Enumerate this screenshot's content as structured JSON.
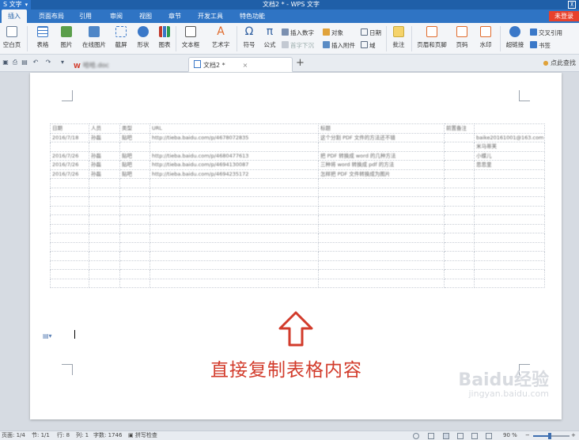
{
  "titlebar": {
    "app_name": "S 文字",
    "doc_title": "文档2 * - WPS 文字",
    "window_button": "⊼"
  },
  "menubar": {
    "tabs": [
      "插入",
      "页面布局",
      "引用",
      "审阅",
      "视图",
      "章节",
      "开发工具",
      "特色功能"
    ],
    "active_tab": "插入",
    "login": "未登录"
  },
  "ribbon": {
    "blank_page": "空白页",
    "table": "表格",
    "picture": "图片",
    "online_picture": "在线图片",
    "screenshot": "截屏",
    "shapes": "形状",
    "chart": "图表",
    "textbox": "文本框",
    "art_text": "艺术字",
    "symbol": "符号",
    "formula": "公式",
    "insert_number": "插入数字",
    "object": "对象",
    "date": "日期",
    "drop_cap": "首字下沉",
    "insert_attachment": "插入附件",
    "field": "域",
    "comment": "批注",
    "header_footer": "页眉和页脚",
    "page_number": "页码",
    "watermark": "水印",
    "hyperlink": "超链接",
    "cross_reference": "交叉引用",
    "bookmark": "书签"
  },
  "tabs": {
    "doc1": "哈哈.doc",
    "doc2": "文档2 *",
    "right_action": "点此查找"
  },
  "table": {
    "rows": [
      [
        "日期",
        "人员",
        "类型",
        "URL",
        "标题",
        "前置备注",
        ""
      ],
      [
        "2016/7/18",
        "孙磊",
        "贴吧",
        "http://tieba.baidu.com/p/4678072835",
        "这个分割 PDF 文件的方法还不错",
        "",
        "baike20161001@163.com"
      ],
      [
        "",
        "",
        "",
        "",
        "",
        "",
        "米马蒂芙"
      ],
      [
        "2016/7/26",
        "孙磊",
        "贴吧",
        "http://tieba.baidu.com/p/4680477613",
        "把 PDF 转换成 word 的几种方法",
        "",
        "小蝶儿"
      ],
      [
        "2016/7/26",
        "孙磊",
        "贴吧",
        "http://tieba.baidu.com/p/4694130087",
        "三种将 word 转换成 pdf 的方法",
        "",
        "思思里"
      ],
      [
        "2016/7/26",
        "孙磊",
        "贴吧",
        "http://tieba.baidu.com/p/4694235172",
        "怎样把 PDF 文件转换成为图片",
        "",
        ""
      ],
      [
        "",
        "",
        "",
        "",
        "",
        "",
        ""
      ],
      [
        "",
        "",
        "",
        "",
        "",
        "",
        ""
      ],
      [
        "",
        "",
        "",
        "",
        "",
        "",
        ""
      ],
      [
        "",
        "",
        "",
        "",
        "",
        "",
        ""
      ],
      [
        "",
        "",
        "",
        "",
        "",
        "",
        ""
      ],
      [
        "",
        "",
        "",
        "",
        "",
        "",
        ""
      ],
      [
        "",
        "",
        "",
        "",
        "",
        "",
        ""
      ],
      [
        "",
        "",
        "",
        "",
        "",
        "",
        ""
      ],
      [
        "",
        "",
        "",
        "",
        "",
        "",
        ""
      ],
      [
        "",
        "",
        "",
        "",
        "",
        "",
        ""
      ],
      [
        "",
        "",
        "",
        "",
        "",
        "",
        ""
      ],
      [
        "",
        "",
        "",
        "",
        "",
        "",
        ""
      ]
    ]
  },
  "annotation": "直接复制表格内容",
  "watermark": {
    "brand": "Baidu经验",
    "url": "jingyan.baidu.com"
  },
  "statusbar": {
    "page": "页面: 1/4",
    "section": "节: 1/1",
    "row": "行: 8",
    "col": "列: 1",
    "word_count": "字数: 1746",
    "spell_check": "拼写检查",
    "zoom": "90 %",
    "zoom_level": 0.9
  },
  "colors": {
    "accent": "#2f74c4",
    "titlebar": "#1f5fa8",
    "annotation": "#d23b2b",
    "login": "#e8412c"
  }
}
